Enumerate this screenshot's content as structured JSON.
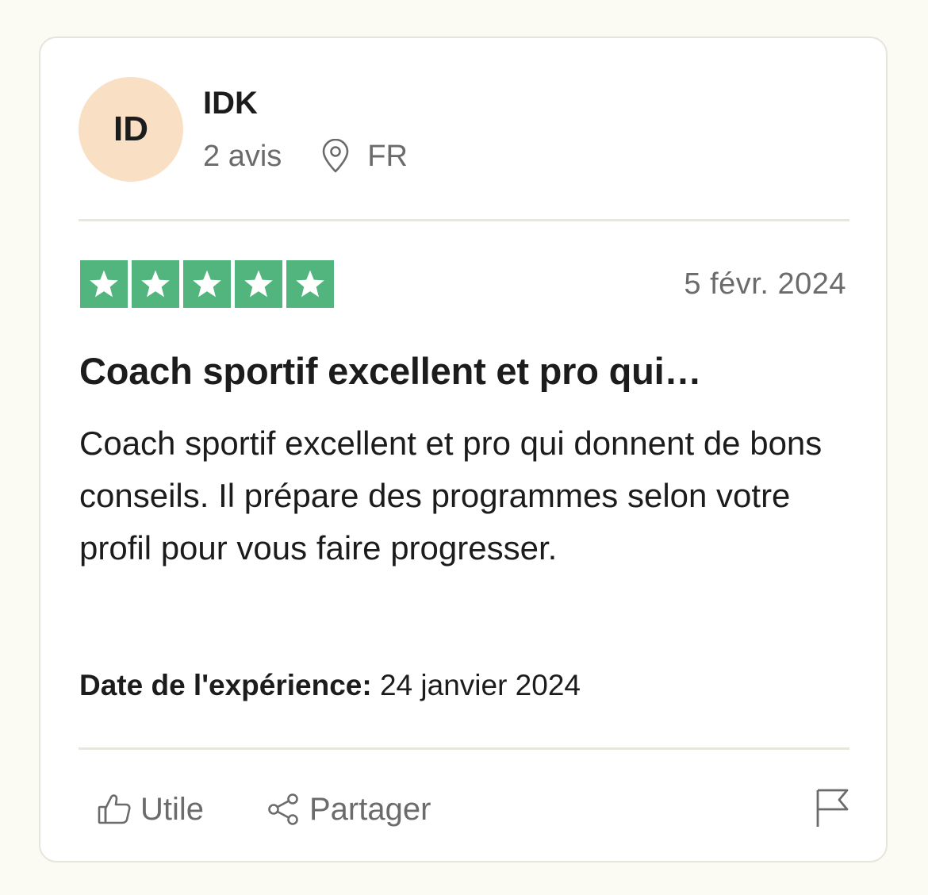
{
  "reviewer": {
    "initials": "ID",
    "name": "IDK",
    "review_count": "2 avis",
    "country": "FR",
    "avatar_color": "#f9dfc4"
  },
  "review": {
    "rating": 5,
    "max_rating": 5,
    "star_color": "#51b57d",
    "date": "5 févr. 2024",
    "title": "Coach sportif excellent et pro qui…",
    "body": "Coach sportif excellent et pro qui donnent de bons conseils. Il prépare des programmes selon votre profil pour vous faire progresser.",
    "experience_label": "Date de l'expérience:",
    "experience_date": "24 janvier 2024"
  },
  "actions": {
    "useful_label": "Utile",
    "share_label": "Partager",
    "useful_icon": "thumbs-up-icon",
    "share_icon": "share-icon",
    "flag_icon": "flag-icon"
  }
}
